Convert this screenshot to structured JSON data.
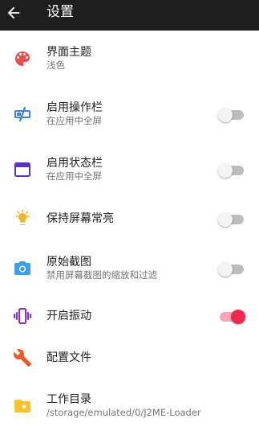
{
  "appbar": {
    "title": "设置",
    "back_icon": "arrow-back-icon"
  },
  "colors": {
    "appbar_bg": "#1e1e1e",
    "accent": "#f0284f",
    "palette_icon": "#ec4b4b",
    "fullscreen_icon": "#3d7fe6",
    "window_icon": "#5b2fd2",
    "bulb_icon": "#f6b22a",
    "camera_icon": "#3aa0e8",
    "vibrate_icon": "#8b2fc7",
    "wrench_icon": "#f0582a",
    "folder_icon": "#f8c12d"
  },
  "settings": [
    {
      "title": "界面主题",
      "summary": "浅色",
      "icon": "palette-icon"
    },
    {
      "title": "启用操作栏",
      "summary": "在应用中全屏",
      "icon": "fullscreen-toggle-icon",
      "toggle": false
    },
    {
      "title": "启用状态栏",
      "summary": "在应用中全屏",
      "icon": "window-icon",
      "toggle": false
    },
    {
      "title": "保持屏幕常亮",
      "icon": "lightbulb-icon",
      "toggle": false
    },
    {
      "title": "原始截图",
      "summary": "禁用屏幕截图的缩放和过滤",
      "icon": "camera-icon",
      "toggle": false
    },
    {
      "title": "开启振动",
      "icon": "vibration-icon",
      "toggle": true
    },
    {
      "title": "配置文件",
      "icon": "wrench-icon"
    },
    {
      "title": "工作目录",
      "summary": "/storage/emulated/0/J2ME-Loader",
      "icon": "folder-star-icon"
    }
  ]
}
